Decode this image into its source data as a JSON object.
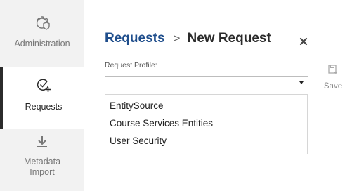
{
  "sidebar": {
    "items": [
      {
        "label": "Administration",
        "icon": "admin-gear-shield-icon"
      },
      {
        "label": "Requests",
        "icon": "check-plus-icon",
        "active": true
      },
      {
        "label": "Metadata\nImport",
        "icon": "download-icon"
      }
    ]
  },
  "header": {
    "breadcrumb_link": "Requests",
    "separator": ">",
    "current": "New Request",
    "close_icon": "close-icon"
  },
  "form": {
    "request_profile_label": "Request Profile:",
    "request_profile_value": "",
    "options": [
      "EntitySource",
      "Course Services Entities",
      "User Security"
    ]
  },
  "toolbar": {
    "save_label": "Save",
    "save_icon": "save-icon"
  },
  "colors": {
    "link_blue": "#1f4e8c",
    "sidebar_bg": "#f2f2f2",
    "active_border": "#2b2b2b"
  }
}
